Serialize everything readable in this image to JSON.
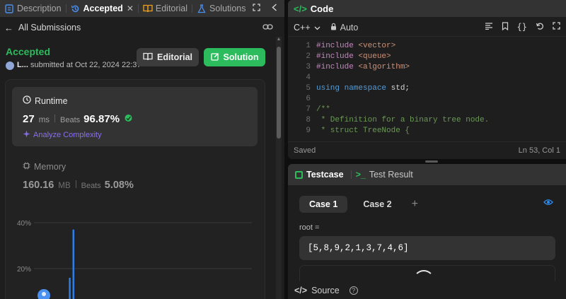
{
  "left_tabs": {
    "description": "Description",
    "accepted": "Accepted",
    "editorial": "Editorial",
    "solutions": "Solutions"
  },
  "subheader": {
    "back_label": "All Submissions"
  },
  "submission": {
    "status": "Accepted",
    "user": "L...",
    "submitted_text": "submitted at Oct 22, 2024 22:37",
    "editorial_button": "Editorial",
    "solution_button": "Solution"
  },
  "runtime": {
    "label": "Runtime",
    "value": "27",
    "unit": "ms",
    "beats_label": "Beats",
    "beats_value": "96.87%",
    "analyze_label": "Analyze Complexity"
  },
  "memory": {
    "label": "Memory",
    "value": "160.16",
    "unit": "MB",
    "beats_label": "Beats",
    "beats_value": "5.08%"
  },
  "chart_data": {
    "type": "bar",
    "y_ticks": [
      "40%",
      "20%"
    ],
    "ylim": [
      0,
      45
    ],
    "bars": [
      {
        "x": 0.23,
        "value": 16
      },
      {
        "x": 0.245,
        "value": 37
      },
      {
        "x": 0.258,
        "value": 4
      }
    ],
    "marker": "user-position"
  },
  "code_panel": {
    "title": "Code",
    "language": "C++",
    "mode": "Auto",
    "status": "Saved",
    "position": "Ln 53, Col 1",
    "lines": [
      {
        "n": "1",
        "parts": [
          [
            "inc",
            "#include "
          ],
          [
            "ang",
            "<vector>"
          ]
        ]
      },
      {
        "n": "2",
        "parts": [
          [
            "inc",
            "#include "
          ],
          [
            "ang",
            "<queue>"
          ]
        ]
      },
      {
        "n": "3",
        "parts": [
          [
            "inc",
            "#include "
          ],
          [
            "ang",
            "<algorithm>"
          ]
        ]
      },
      {
        "n": "4",
        "parts": []
      },
      {
        "n": "5",
        "parts": [
          [
            "key",
            "using "
          ],
          [
            "key",
            "namespace "
          ],
          [
            "pl",
            "std;"
          ]
        ]
      },
      {
        "n": "6",
        "parts": []
      },
      {
        "n": "7",
        "parts": [
          [
            "cm",
            "/**"
          ]
        ]
      },
      {
        "n": "8",
        "parts": [
          [
            "cm",
            " * Definition for a binary tree node."
          ]
        ]
      },
      {
        "n": "9",
        "parts": [
          [
            "cm",
            " * struct TreeNode {"
          ]
        ]
      }
    ]
  },
  "test_panel": {
    "testcase_tab": "Testcase",
    "result_tab": "Test Result",
    "case1": "Case 1",
    "case2": "Case 2",
    "input_label": "root =",
    "input_value": "[5,8,9,2,1,3,7,4,6]",
    "source_label": "Source"
  },
  "colors": {
    "accent_green": "#2cbb5d",
    "link_blue": "#2a8cf0",
    "analyze_purple": "#8a6ff0"
  }
}
